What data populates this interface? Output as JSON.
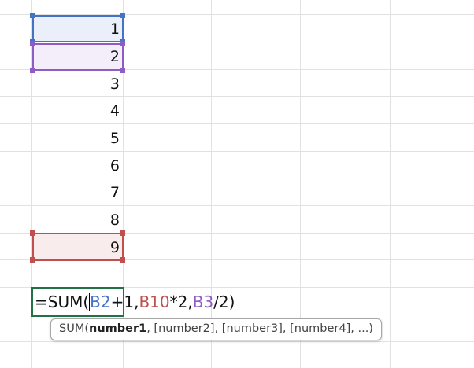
{
  "cells": {
    "b1": "1",
    "b2": "2",
    "b3": "3",
    "b4": "4",
    "b5": "5",
    "b6": "6",
    "b7": "7",
    "b8": "8",
    "b9": "9"
  },
  "formula": {
    "prefix": "=SUM(",
    "ref1": "B2",
    "mid1": "+1,",
    "ref2": "B10",
    "mid2": "*2,",
    "ref3": "B3",
    "suffix": "/2)"
  },
  "tooltip": {
    "func": "SUM(",
    "arg_active": "number1",
    "args_rest": ", [number2], [number3], [number4], ...)"
  },
  "colors": {
    "ref_blue": "#4472c4",
    "ref_purple": "#8e5cc4",
    "ref_red": "#c0504d",
    "edit_border": "#217346"
  }
}
